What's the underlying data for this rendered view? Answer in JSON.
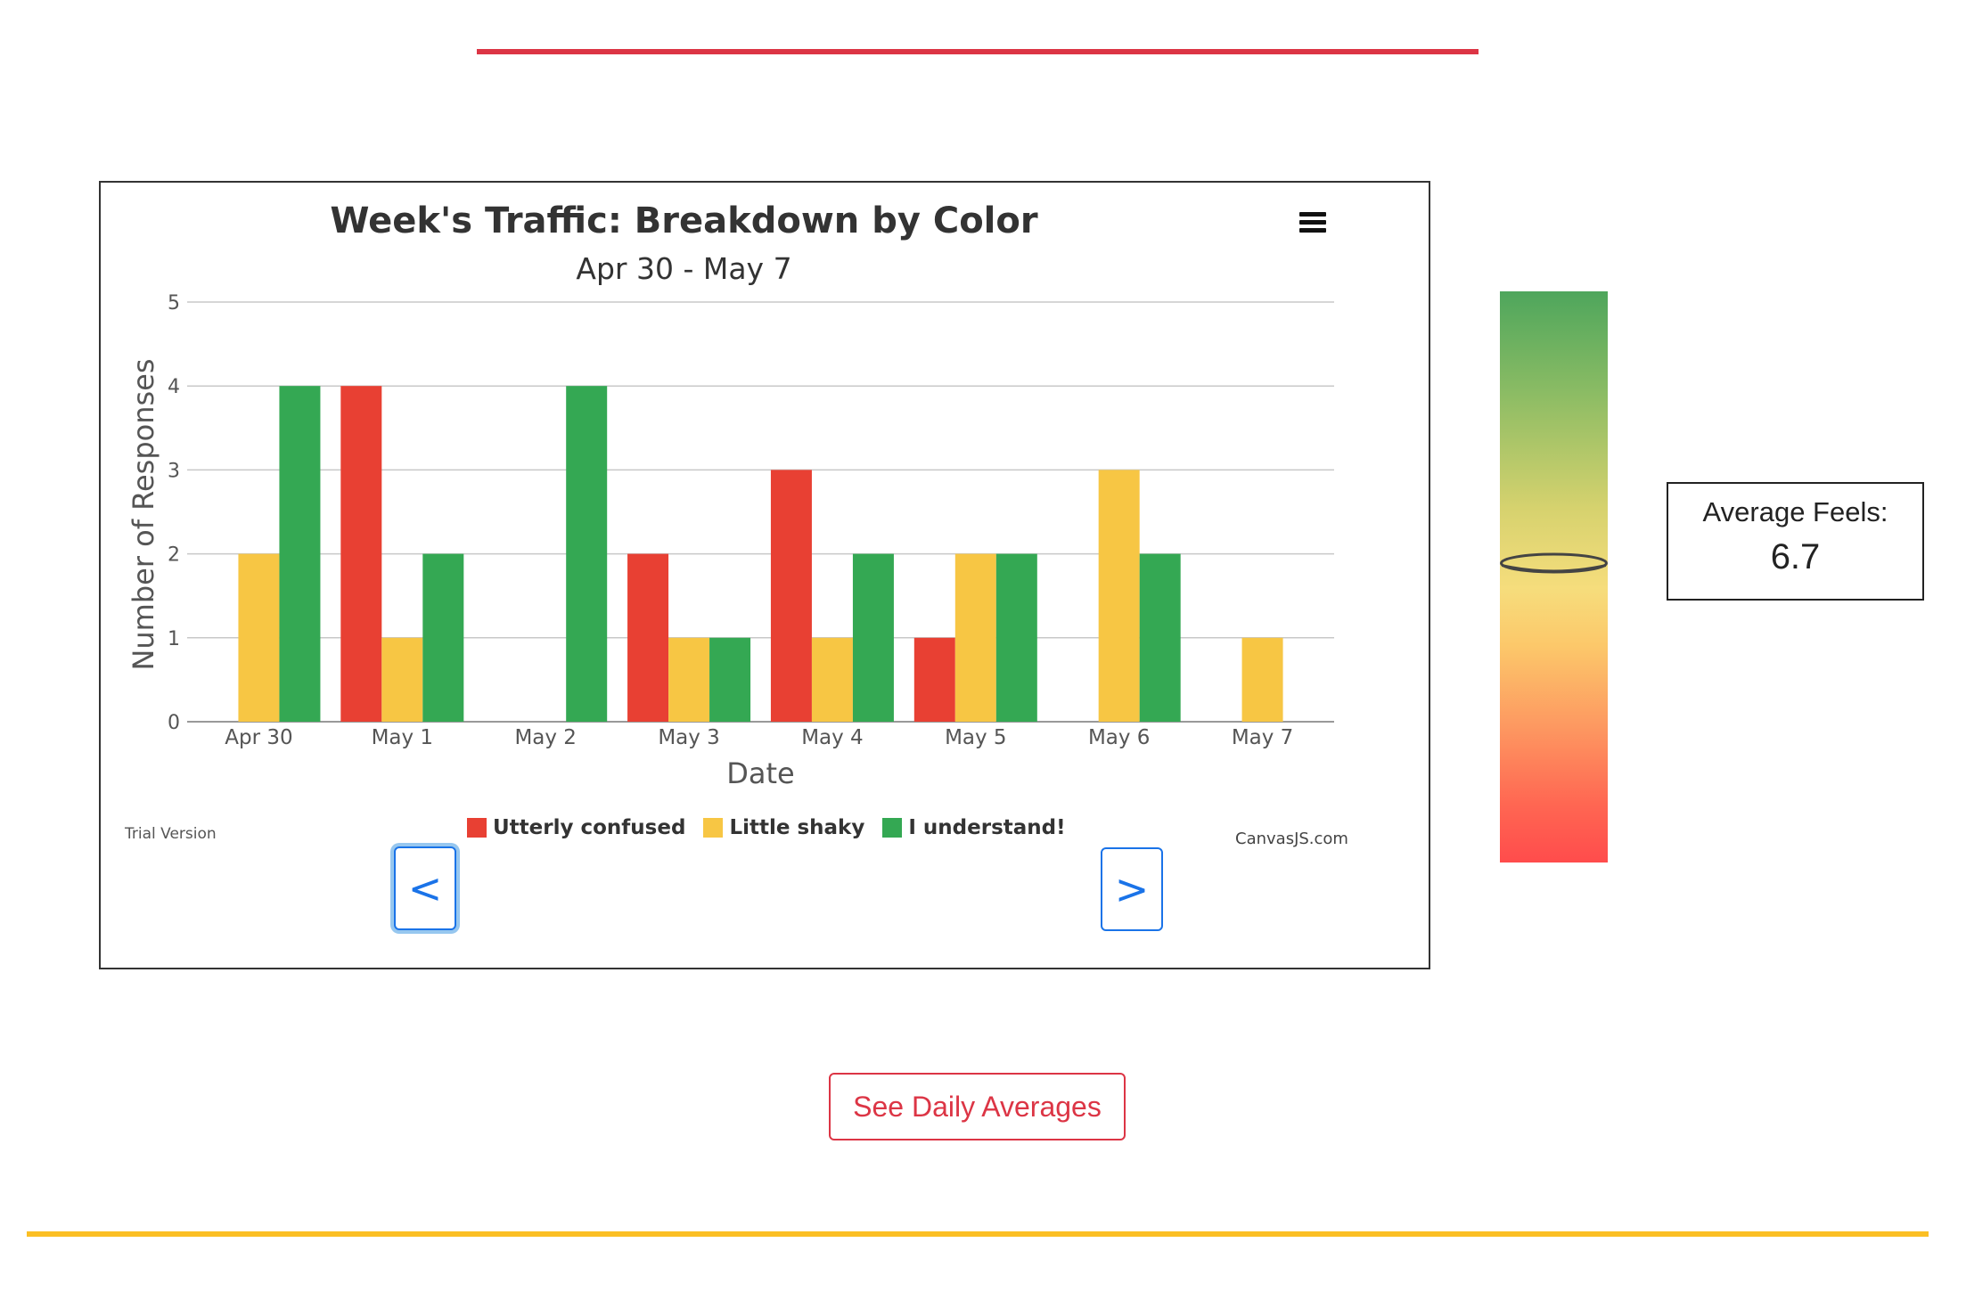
{
  "chart_data": {
    "type": "bar",
    "title": "Week's Traffic: Breakdown by Color",
    "subtitle": "Apr 30 - May 7",
    "xlabel": "Date",
    "ylabel": "Number of Responses",
    "ylim": [
      0,
      5
    ],
    "yticks": [
      "0",
      "1",
      "2",
      "3",
      "4",
      "5"
    ],
    "grid": true,
    "legend_position": "bottom",
    "categories": [
      "Apr 30",
      "May 1",
      "May 2",
      "May 3",
      "May 4",
      "May 5",
      "May 6",
      "May 7"
    ],
    "series": [
      {
        "name": "Utterly confused",
        "color": "#e84033",
        "values": [
          0,
          4,
          0,
          2,
          3,
          1,
          0,
          0
        ]
      },
      {
        "name": "Little shaky",
        "color": "#f7c644",
        "values": [
          2,
          1,
          0,
          1,
          1,
          2,
          3,
          1
        ]
      },
      {
        "name": "I understand!",
        "color": "#34a853",
        "values": [
          4,
          2,
          4,
          1,
          2,
          2,
          2,
          0
        ]
      }
    ]
  },
  "chart_meta": {
    "trial_text": "Trial Version",
    "credit_text": "CanvasJS.com"
  },
  "nav": {
    "prev_label": "<",
    "next_label": ">"
  },
  "gauge": {
    "icon": "gauge-marker-icon",
    "level_fraction": 0.52
  },
  "average": {
    "label": "Average Feels:",
    "value": "6.7"
  },
  "actions": {
    "daily_averages_label": "See Daily Averages"
  },
  "colors": {
    "top_rule": "#dc3545",
    "bottom_rule": "#fbbf24",
    "nav_accent": "#1a73e8",
    "action_accent": "#dc3545"
  }
}
